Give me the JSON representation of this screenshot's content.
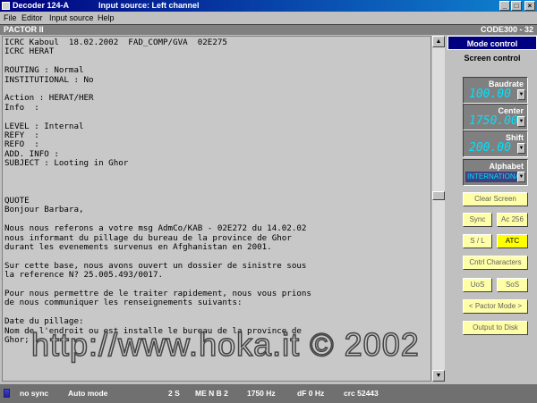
{
  "window": {
    "title": "Decoder 124-A",
    "subtitle": "Input source: Left channel",
    "buttons": {
      "minimize": "_",
      "maximize": "□",
      "close": "×"
    }
  },
  "menu": [
    "File",
    "Editor",
    "Input source",
    "Help"
  ],
  "mode_bar": {
    "left": "PACTOR II",
    "right": "CODE300 - 32"
  },
  "text_lines": [
    "ICRC Kaboul  18.02.2002  FAD_COMP/GVA  02E275",
    "ICRC HERAT",
    "",
    "ROUTING : Normal",
    "INSTITUTIONAL : No",
    "",
    "Action : HERAT/HER",
    "Info  :",
    "",
    "LEVEL : Internal",
    "REFY  :",
    "REFO  :",
    "ADD. INFO :",
    "SUBJECT : Looting in Ghor",
    "",
    "",
    "",
    "QUOTE",
    "Bonjour Barbara,",
    "",
    "Nous nous referons a votre msg AdmCo/KAB - 02E272 du 14.02.02",
    "nous informant du pillage du bureau de la province de Ghor",
    "durant les evenements survenus en Afghanistan en 2001.",
    "",
    "Sur cette base, nous avons ouvert un dossier de sinistre sous",
    "la reference N? 25.005.493/0017.",
    "",
    "Pour nous permettre de le traiter rapidement, nous vous prions",
    "de nous communiquer les renseignements suivants:",
    "",
    "Date du pillage:",
    "Nom de l'endroit ou est installe le bureau de la province de",
    "Ghor;"
  ],
  "watermark": "http://www.hoka.it  © 2002",
  "scroll": {
    "up": "▲",
    "down": "▼"
  },
  "right_panel": {
    "mode_control": "Mode control",
    "screen_control": "Screen control",
    "baudrate": {
      "label": "Baudrate",
      "value": "100.00"
    },
    "center": {
      "label": "Center",
      "value": "1750.00"
    },
    "shift": {
      "label": "Shift",
      "value": "200.00"
    },
    "alphabet": {
      "label": "Alphabet",
      "value": "INTERNATIONAL"
    },
    "dropdown_glyph": "▼",
    "buttons": {
      "clear_screen": "Clear Screen",
      "sync": "Sync",
      "ac256": "Ac 256",
      "sl": "S / L",
      "atc": "ATC",
      "cntrl_characters": "Cntrl Characters",
      "uos": "UoS",
      "sos": "SoS",
      "pactor_mode": "< Pactor Mode >",
      "output_to_disk": "Output to Disk"
    }
  },
  "status": {
    "sync": "no sync",
    "mode": "Auto mode",
    "time": "2 S",
    "code": "ME N B 2",
    "freq": "1750 Hz",
    "df": "dF 0 Hz",
    "crc": "crc 52443"
  }
}
